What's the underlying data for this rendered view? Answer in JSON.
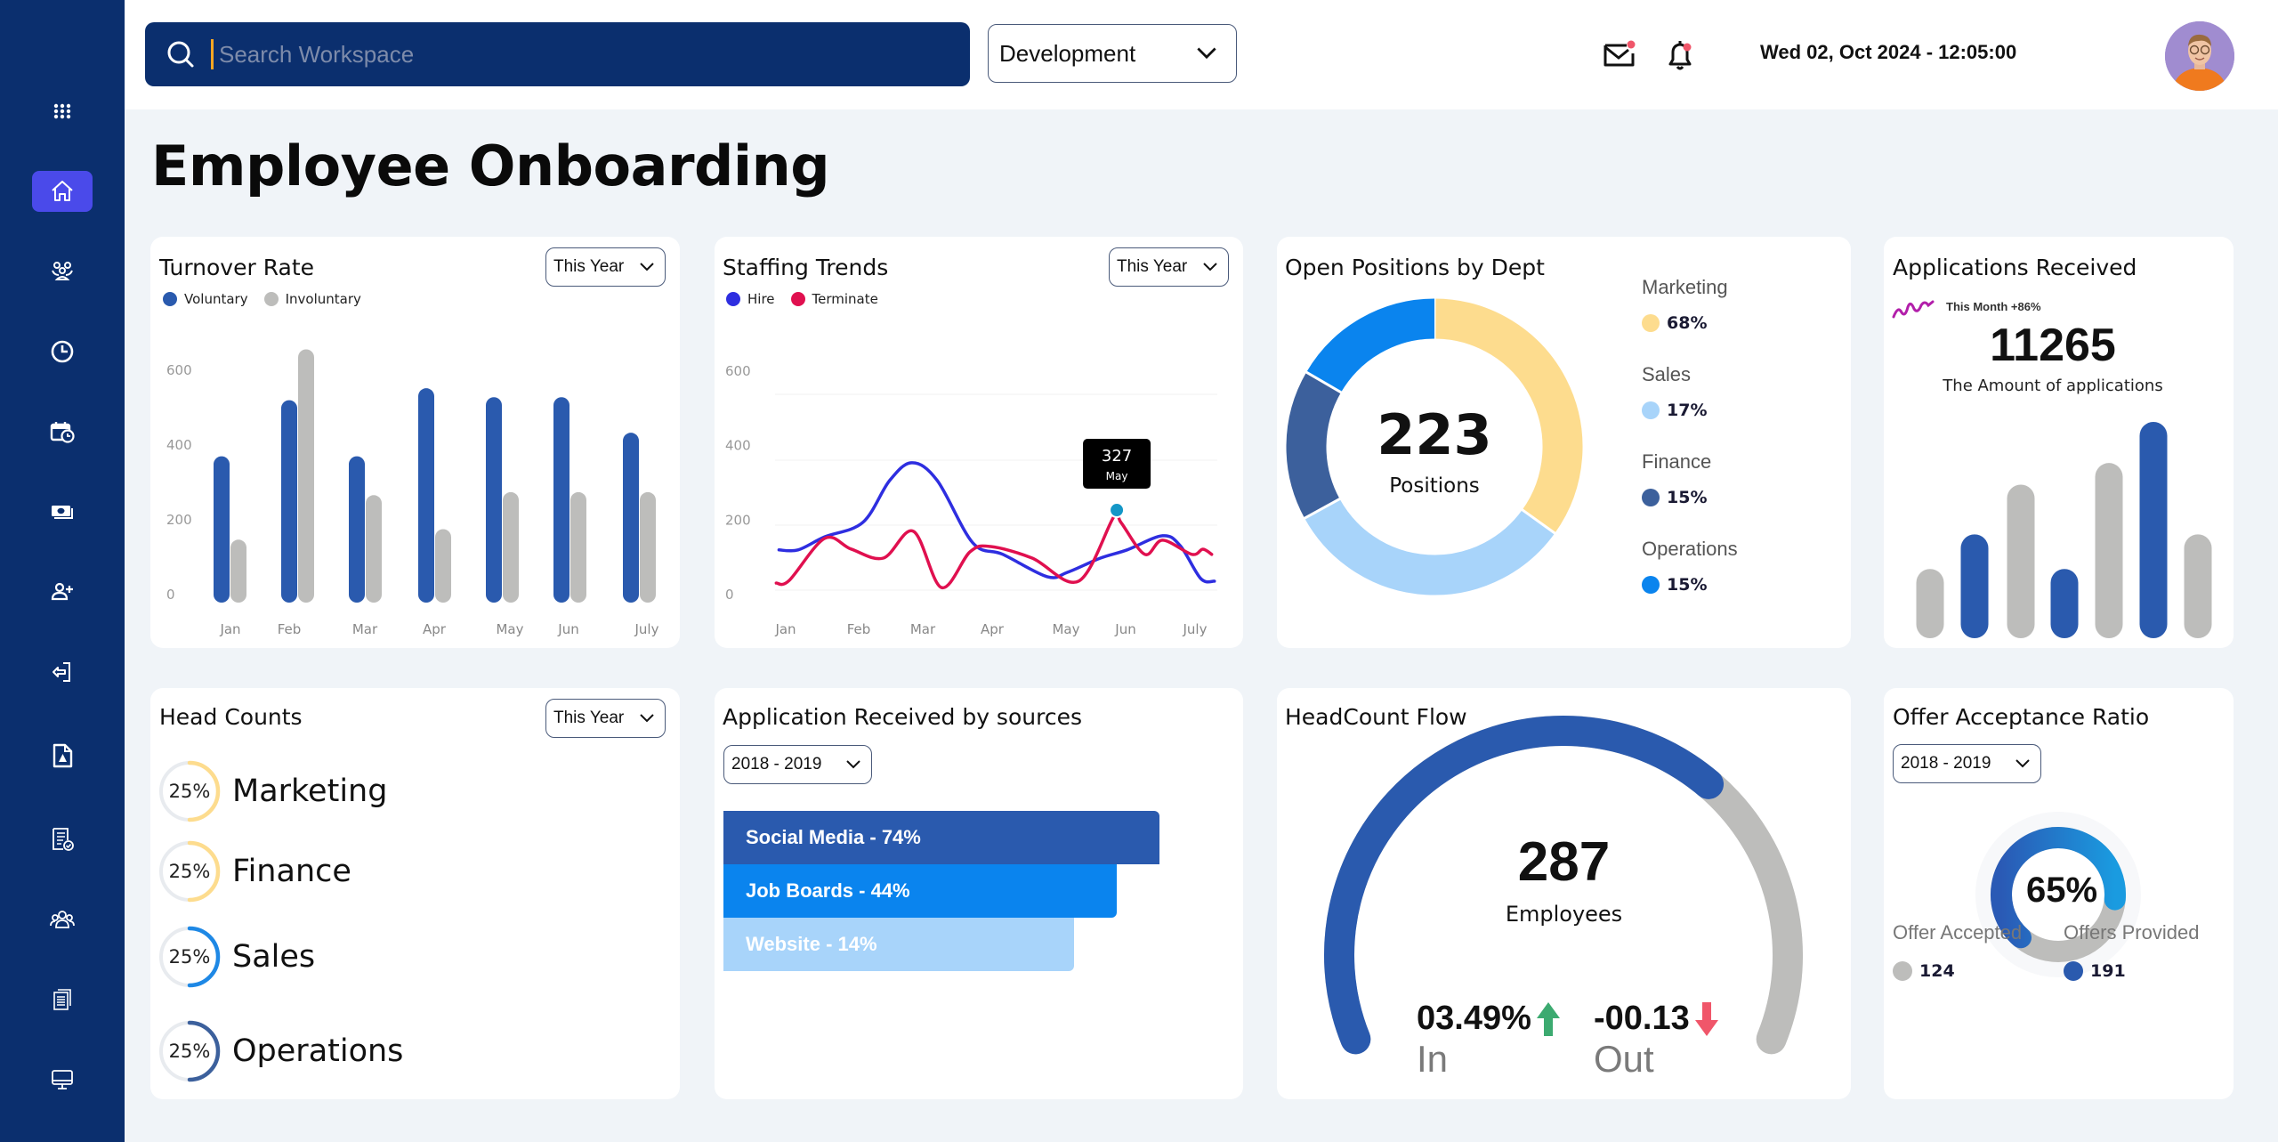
{
  "colors": {
    "sidebar": "#0B2F6E",
    "active": "#4A4AEA",
    "primary_blue": "#2A5AAE",
    "gray": "#BDBDBB",
    "hire": "#2E2EE0",
    "terminate": "#E0104F",
    "marketing": "#FDDC8E",
    "sales": "#A8D4FA",
    "finance": "#3C609C",
    "operations": "#0A84EE",
    "up": "#3CAA70",
    "down": "#F0566A"
  },
  "sidebar": {
    "items": [
      {
        "icon": "apps-grid-icon",
        "active": false
      },
      {
        "icon": "home-icon",
        "active": true
      },
      {
        "icon": "team-icon",
        "active": false
      },
      {
        "icon": "clock-icon",
        "active": false
      },
      {
        "icon": "calendar-clock-icon",
        "active": false
      },
      {
        "icon": "payroll-money-icon",
        "active": false
      },
      {
        "icon": "add-user-icon",
        "active": false
      },
      {
        "icon": "login-icon",
        "active": false
      },
      {
        "icon": "document-pdf-icon",
        "active": false
      },
      {
        "icon": "checklist-approved-icon",
        "active": false
      },
      {
        "icon": "group-icon",
        "active": false
      },
      {
        "icon": "documents-icon",
        "active": false
      },
      {
        "icon": "monitor-icon",
        "active": false
      }
    ]
  },
  "header": {
    "search_placeholder": "Search Workspace",
    "department": "Development",
    "datetime": "Wed 02, Oct 2024 - 12:05:00",
    "mail_has_notification": true,
    "bell_has_notification": true
  },
  "page": {
    "title": "Employee Onboarding"
  },
  "cards": {
    "turnover": {
      "title": "Turnover Rate",
      "filter": "This Year"
    },
    "staffing": {
      "title": "Staffing Trends",
      "filter": "This Year",
      "tooltip_value": "327",
      "tooltip_label": "May"
    },
    "open_positions": {
      "title": "Open Positions by Dept",
      "total": "223",
      "total_label": "Positions"
    },
    "applications": {
      "title": "Applications Received",
      "trend_label": "This Month +86%",
      "total": "11265",
      "subtitle": "The Amount of applications"
    },
    "head_counts": {
      "title": "Head Counts",
      "filter": "This Year",
      "items": [
        {
          "name": "Marketing",
          "label": "25%",
          "fill": 0.5,
          "color": "#FDDC8E"
        },
        {
          "name": "Finance",
          "label": "25%",
          "fill": 0.5,
          "color": "#FDDC8E"
        },
        {
          "name": "Sales",
          "label": "25%",
          "fill": 0.5,
          "color": "#1E88E5"
        },
        {
          "name": "Operations",
          "label": "25%",
          "fill": 0.5,
          "color": "#3C609C"
        }
      ]
    },
    "sources": {
      "title": "Application Received by sources",
      "filter": "2018 - 2019",
      "items": [
        {
          "label": "Social Media - 74%",
          "share": 1.0,
          "color": "#2A5AAE"
        },
        {
          "label": "Job Boards - 44%",
          "share": 0.902,
          "color": "#0A84EE"
        },
        {
          "label": "Website - 14%",
          "share": 0.804,
          "color": "#A8D4FA"
        }
      ]
    },
    "headcount_flow": {
      "title": "HeadCount Flow",
      "total": "287",
      "total_label": "Employees",
      "fill": 0.68,
      "in_value": "03.49%",
      "in_label": "In",
      "out_value": "-00.13",
      "out_label": "Out"
    },
    "offer_ratio": {
      "title": "Offer Acceptance Ratio",
      "filter": "2018 - 2019",
      "percent_label": "65%",
      "fill": 0.65,
      "accepted_label": "Offer Accepted",
      "accepted_value": "124",
      "provided_label": "Offers Provided",
      "provided_value": "191"
    }
  },
  "chart_data": [
    {
      "id": "turnover",
      "type": "bar",
      "title": "Turnover Rate",
      "categories": [
        "Jan",
        "Feb",
        "Mar",
        "Apr",
        "May",
        "Jun",
        "July"
      ],
      "series": [
        {
          "name": "Voluntary",
          "color": "#2A5AAE",
          "values": [
            370,
            520,
            370,
            552,
            528,
            528,
            433
          ]
        },
        {
          "name": "Involuntary",
          "color": "#BDBDBB",
          "values": [
            147,
            656,
            266,
            175,
            274,
            274,
            274
          ]
        }
      ],
      "yticks": [
        0,
        200,
        400,
        600
      ],
      "ylim": [
        0,
        600
      ],
      "legend": "top-left",
      "grid": false
    },
    {
      "id": "staffing",
      "type": "line",
      "title": "Staffing Trends",
      "categories": [
        "Jan",
        "Feb",
        "Mar",
        "Apr",
        "May",
        "Jun",
        "July"
      ],
      "series": [
        {
          "name": "Hire",
          "color": "#2E2EE0",
          "x": [
            -0.06,
            0.22,
            0.61,
            1.17,
            1.56,
            1.89,
            2.26,
            2.78,
            3.22,
            3.87,
            4.17,
            4.65,
            5.04,
            5.56,
            5.82,
            6.12,
            6.32
          ],
          "y": [
            120,
            120,
            155,
            194,
            306,
            354,
            306,
            139,
            108,
            48,
            60,
            98,
            120,
            158,
            131,
            43,
            36
          ]
        },
        {
          "name": "Terminate",
          "color": "#E0104F",
          "x": [
            -0.1,
            0.09,
            0.61,
            1.0,
            1.47,
            1.91,
            2.32,
            2.74,
            3.04,
            3.65,
            4.33,
            4.85,
            4.95,
            5.3,
            5.56,
            5.99,
            6.15,
            6.28
          ],
          "y": [
            31,
            38,
            151,
            122,
            98,
            170,
            19,
            115,
            129,
            98,
            36,
            210,
            194,
            108,
            146,
            108,
            122,
            108
          ]
        }
      ],
      "highlight": {
        "x": 4.89,
        "y": 227,
        "label_value": "327",
        "label_month": "May"
      },
      "yticks": [
        0,
        200,
        400,
        600
      ],
      "ylim": [
        0,
        600
      ],
      "legend": "top-left",
      "grid": true
    },
    {
      "id": "open_positions",
      "type": "pie",
      "title": "Open Positions by Dept",
      "center_value": 223,
      "slices": [
        {
          "name": "Marketing",
          "label": "68%",
          "arc_share": 0.349,
          "color": "#FDDC8E"
        },
        {
          "name": "Sales",
          "label": "17%",
          "arc_share": 0.321,
          "color": "#A8D4FA"
        },
        {
          "name": "Finance",
          "label": "15%",
          "arc_share": 0.164,
          "color": "#3C609C"
        },
        {
          "name": "Operations",
          "label": "15%",
          "arc_share": 0.166,
          "color": "#0A84EE"
        }
      ],
      "legend": "right"
    },
    {
      "id": "applications",
      "type": "bar",
      "title": "Applications Received",
      "values": [
        0.32,
        0.48,
        0.71,
        0.32,
        0.81,
        1.0,
        0.48
      ],
      "colors": [
        "#BDBDBB",
        "#2A5AAE",
        "#BDBDBB",
        "#2A5AAE",
        "#BDBDBB",
        "#2A5AAE",
        "#BDBDBB"
      ],
      "grid": false
    }
  ]
}
